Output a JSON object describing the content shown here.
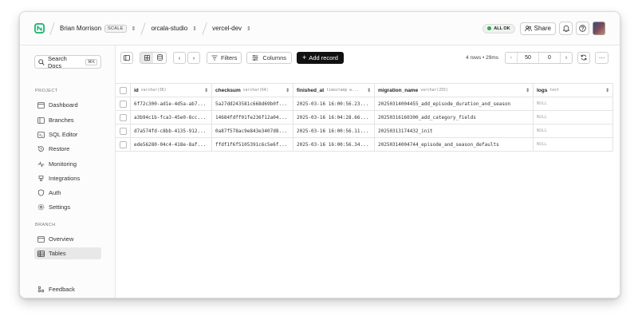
{
  "header": {
    "user": "Brian Morrison",
    "plan_badge": "SCALE",
    "project": "orcala-studio",
    "branch": "vercel-dev",
    "status": "ALL OK",
    "share_label": "Share"
  },
  "sidebar": {
    "search_label": "Search Docs",
    "search_shortcut": "⌘K",
    "project_section": "PROJECT",
    "project_items": [
      {
        "label": "Dashboard",
        "icon": "dashboard-icon"
      },
      {
        "label": "Branches",
        "icon": "branches-icon"
      },
      {
        "label": "SQL Editor",
        "icon": "sql-editor-icon"
      },
      {
        "label": "Restore",
        "icon": "restore-icon"
      },
      {
        "label": "Monitoring",
        "icon": "monitoring-icon"
      },
      {
        "label": "Integrations",
        "icon": "integrations-icon"
      },
      {
        "label": "Auth",
        "icon": "auth-icon"
      },
      {
        "label": "Settings",
        "icon": "settings-icon"
      }
    ],
    "branch_section": "BRANCH",
    "branch_items": [
      {
        "label": "Overview",
        "icon": "overview-icon"
      },
      {
        "label": "Tables",
        "icon": "table-icon",
        "active": true
      }
    ],
    "feedback_label": "Feedback"
  },
  "toolbar": {
    "filters_label": "Filters",
    "columns_label": "Columns",
    "add_record_label": "Add record",
    "row_info": "4 rows • 29ms",
    "page_size": "50",
    "offset": "0"
  },
  "table": {
    "columns": [
      {
        "name": "id",
        "type": "varchar(36)"
      },
      {
        "name": "checksum",
        "type": "varchar(64)"
      },
      {
        "name": "finished_at",
        "type": "timestamp w..."
      },
      {
        "name": "migration_name",
        "type": "varchar(255)"
      },
      {
        "name": "logs",
        "type": "text"
      }
    ],
    "rows": [
      [
        "6f72c300-ad1e-4d5a-ab7...",
        "5a27dd243581c668d69b0f...",
        "2025-03-16 16:00:56.23...",
        "20250314004455_add_episode_duration_and_season",
        "NULL"
      ],
      [
        "a3b94c1b-fca3-45e0-8cc...",
        "14684fdff01fe236f12a04...",
        "2025-03-16 16:04:28.66...",
        "20250316160300_add_category_fields",
        "NULL"
      ],
      [
        "d7a574fd-c8bb-4135-912...",
        "0a87f578ac9e843e3407d8...",
        "2025-03-16 16:00:56.11...",
        "20250313174432_init",
        "NULL"
      ],
      [
        "ede56280-04c4-418e-8af...",
        "ffdf1f6f5105391c6c5e6f...",
        "2025-03-16 16:00:56.34...",
        "20250314004744_episode_and_season_defaults",
        "NULL"
      ]
    ]
  },
  "colors": {
    "accent": "#111111",
    "status_ok": "#2fa84f",
    "logo": "#22b573"
  }
}
